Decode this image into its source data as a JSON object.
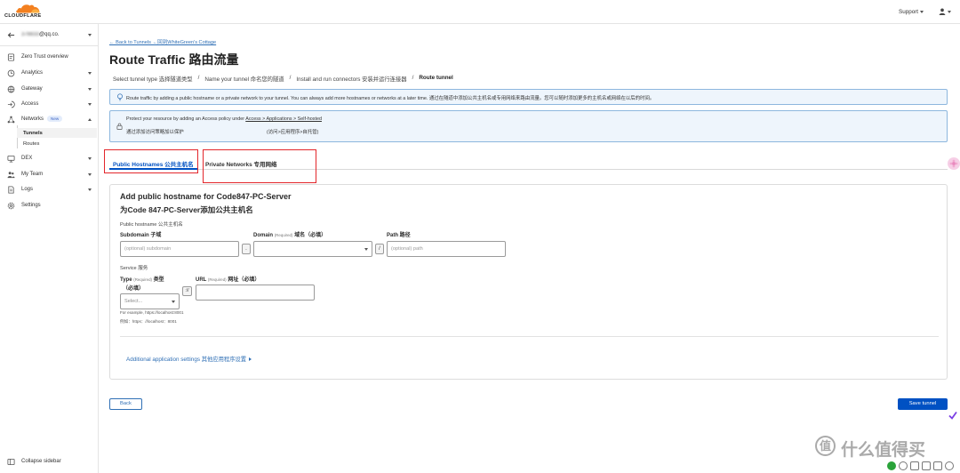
{
  "brand": {
    "logo_text": "CLOUDFLARE",
    "accent": "#f38020"
  },
  "topbar": {
    "support_label": "Support",
    "user_icon": "user-icon"
  },
  "sidebar": {
    "account_masked": "378833",
    "account_domain": "@qq.co.",
    "items": [
      {
        "label": "Zero Trust overview",
        "icon": "overview-icon"
      },
      {
        "label": "Analytics",
        "icon": "analytics-icon"
      },
      {
        "label": "Gateway",
        "icon": "gateway-icon"
      },
      {
        "label": "Access",
        "icon": "access-icon"
      },
      {
        "label": "Networks",
        "icon": "networks-icon",
        "badge": "New"
      },
      {
        "label": "DEX",
        "icon": "dex-icon"
      },
      {
        "label": "My Team",
        "icon": "team-icon"
      },
      {
        "label": "Logs",
        "icon": "logs-icon"
      },
      {
        "label": "Settings",
        "icon": "gear-icon"
      }
    ],
    "networks_children": [
      "Tunnels",
      "Routes"
    ],
    "active_child": "Tunnels",
    "collapse_label": "Collapse sidebar"
  },
  "page": {
    "back_link": "← Back to Tunnels ←回到WhiteGreen's Cottage",
    "title": "Route Traffic 路由流量",
    "steps": [
      {
        "label": "Select tunnel type 选择隧道类型",
        "current": false
      },
      {
        "label": "Name your tunnel 命名您的隧道",
        "current": false
      },
      {
        "label": "Install and run connectors 安装并运行连接器",
        "current": false
      },
      {
        "label": "Route tunnel",
        "current": true
      }
    ],
    "step_separator": "/",
    "info_text": "Route traffic by adding a public hostname or a private network to your tunnel. You can always add more hostnames or networks at a later time. 通过在隧道中添加公共主机名或专用网络来路由流量。您可以随时添加更多的主机名或网络在以后的时间。",
    "access_note": {
      "prefix": "Protect your resource by adding an Access policy under ",
      "link": "Access > Applications > Self-hosted",
      "prefix_cn": "通过添加访问策略加以保护",
      "link_cn": "(访问>应用程序>自托管)"
    },
    "tabs": [
      {
        "label": "Public Hostnames 公共主机名",
        "active": true
      },
      {
        "label": "Private Networks 专用网络",
        "active": false
      }
    ]
  },
  "form": {
    "heading": "Add public hostname for Code847-PC-Server",
    "heading_cn": "为Code 847-PC-Server添加公共主机名",
    "public_hostname_label": "Public hostname 公共主机名",
    "subdomain": {
      "label": "Subdomain 子域",
      "placeholder": "(optional) subdomain",
      "value": ""
    },
    "dot": ".",
    "domain": {
      "label": "Domain",
      "required": "(Required)",
      "label_cn": "域名（必填）",
      "value": ""
    },
    "slash": "/",
    "path": {
      "label": "Path 路径",
      "placeholder": "(optional) path",
      "value": ""
    },
    "service_label": "Service 服务",
    "type": {
      "label": "Type",
      "required": "(Required)",
      "label_cn": "类型",
      "label_cn_line2": "（必填）",
      "placeholder": "Select..."
    },
    "scheme_sep": "://",
    "url": {
      "label": "URL",
      "required": "(Required)",
      "label_cn": "网址（必填）",
      "value": ""
    },
    "example": "For example, https://localhost:8001",
    "example_cn": "例如：https：//localhost：8001",
    "additional": "Additional application settings 其他应用程序设置"
  },
  "footer": {
    "back": "Back",
    "save": "Save tunnel"
  },
  "watermark": {
    "glyph": "值",
    "text": "什么值得买"
  },
  "colors": {
    "link": "#2f6fb5",
    "primary_button": "#0051c3",
    "annotation_red": "#e3262b",
    "info_border": "#8db7de",
    "info_bg": "#eef5fc"
  }
}
